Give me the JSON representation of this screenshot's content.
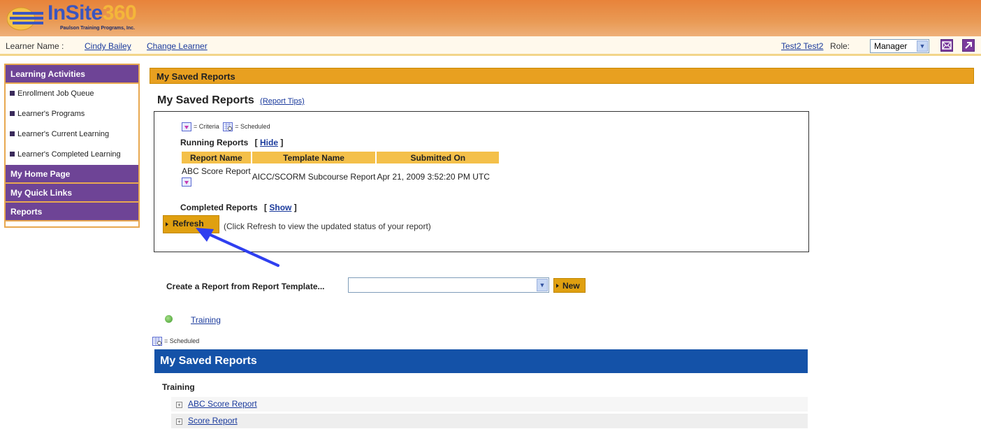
{
  "header": {
    "brand_prefix": "InSite",
    "brand_number": "360",
    "brand_subtitle": "Paulson Training Programs, Inc.",
    "learner_label": "Learner Name :",
    "learner_name": "Cindy Bailey",
    "change_learner": "Change Learner",
    "user_name": "Test2 Test2",
    "role_label": "Role:",
    "role_value": "Manager",
    "icons": [
      "mail-icon",
      "external-link-icon"
    ]
  },
  "sidebar": {
    "sections": [
      {
        "label": "Learning Activities"
      },
      {
        "label": "My Home Page"
      },
      {
        "label": "My Quick Links"
      },
      {
        "label": "Reports"
      }
    ],
    "items": [
      {
        "label": "Enrollment Job Queue"
      },
      {
        "label": "Learner's Programs"
      },
      {
        "label": "Learner's Current Learning"
      },
      {
        "label": "Learner's Completed Learning"
      }
    ]
  },
  "main": {
    "section_header": "My Saved Reports",
    "title": "My Saved Reports",
    "report_tips": "(Report Tips)",
    "legend_criteria": "= Criteria",
    "legend_scheduled": "= Scheduled",
    "running_label": "Running Reports",
    "hide_link": "Hide",
    "bracket_open": "[",
    "bracket_close": "]",
    "columns": [
      "Report Name",
      "Template Name",
      "Submitted On"
    ],
    "running_rows": [
      {
        "report_name": "ABC Score Report",
        "template_name": "AICC/SCORM Subcourse Report",
        "submitted_on": "Apr 21, 2009 3:52:20 PM UTC"
      }
    ],
    "completed_label": "Completed Reports",
    "show_link": "Show",
    "refresh_label": "Refresh",
    "refresh_hint": "(Click Refresh to view the updated status of your report)",
    "create_label": "Create a Report from Report Template...",
    "template_value": "",
    "new_label": "New",
    "training_link": "Training",
    "scheduled_legend": "= Scheduled",
    "saved_header": "My Saved Reports",
    "category": "Training",
    "saved_reports": [
      {
        "label": "ABC Score Report"
      },
      {
        "label": "Score Report"
      }
    ]
  },
  "colors": {
    "header_orange": "#e8833a",
    "sidebar_purple": "#6e4496",
    "section_gold": "#e8a020",
    "table_header_gold": "#f4c04a",
    "saved_blue": "#1452a8",
    "link_blue": "#1a3a9c",
    "annotation_arrow": "#2f3ff0"
  }
}
